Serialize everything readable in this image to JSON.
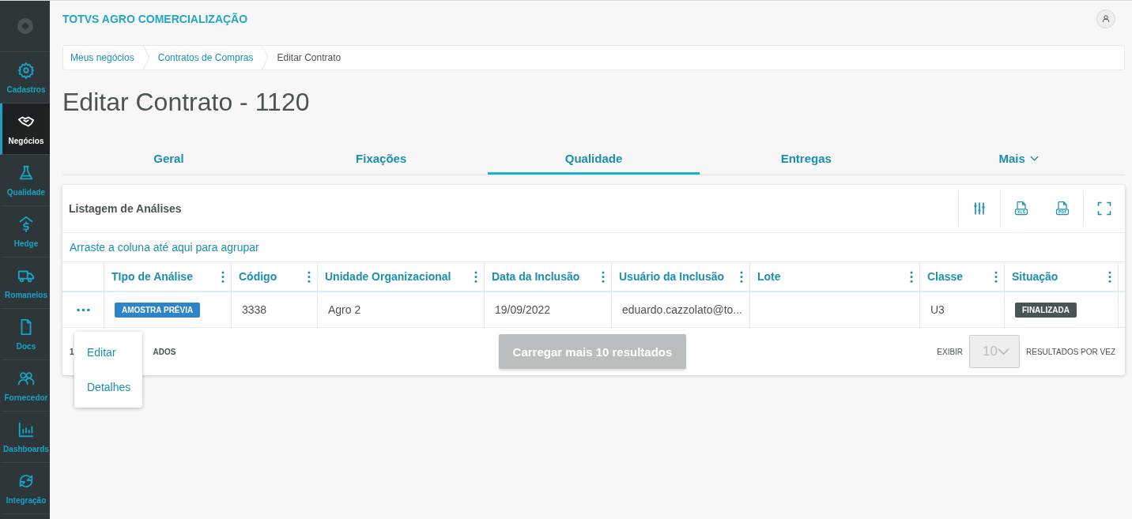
{
  "sidebar": {
    "items": [
      {
        "label": "Cadastros",
        "selected": false
      },
      {
        "label": "Negócios",
        "selected": true
      },
      {
        "label": "Qualidade",
        "selected": false
      },
      {
        "label": "Hedge",
        "selected": false
      },
      {
        "label": "Romaneios",
        "selected": false
      },
      {
        "label": "Docs",
        "selected": false
      },
      {
        "label": "Fornecedor",
        "selected": false
      },
      {
        "label": "Dashboards",
        "selected": false
      },
      {
        "label": "Integração",
        "selected": false
      }
    ]
  },
  "header": {
    "title": "TOTVS AGRO COMERCIALIZAÇÃO"
  },
  "breadcrumb": [
    "Meus negócios",
    "Contratos de Compras",
    "Editar Contrato"
  ],
  "page_title": "Editar Contrato - 1120",
  "tabs": [
    {
      "label": "Geral",
      "selected": false,
      "kind": "plain"
    },
    {
      "label": "Fixações",
      "selected": false,
      "kind": "plain"
    },
    {
      "label": "Qualidade",
      "selected": true,
      "kind": "plain"
    },
    {
      "label": "Entregas",
      "selected": false,
      "kind": "plain"
    },
    {
      "label": "Mais",
      "selected": false,
      "kind": "more"
    }
  ],
  "table": {
    "title": "Listagem de Análises",
    "group_hint": "Arraste a coluna até aqui para agrupar",
    "columns": [
      "TIpo de Análise",
      "Código",
      "Unidade Organizacional",
      "Data da Inclusão",
      "Usuário da Inclusão",
      "Lote",
      "Classe",
      "Situação"
    ],
    "rows": [
      {
        "cells": [
          {
            "kind": "tag",
            "text": "AMOSTRA PRÉVIA",
            "color": "#2c85c8"
          },
          {
            "kind": "text",
            "text": "3338"
          },
          {
            "kind": "text",
            "text": "Agro 2"
          },
          {
            "kind": "text",
            "text": "19/09/2022"
          },
          {
            "kind": "text",
            "text": "eduardo.cazzolato@to..."
          },
          {
            "kind": "empty"
          },
          {
            "kind": "text",
            "text": "U3"
          },
          {
            "kind": "tag",
            "text": "FINALIZADA",
            "color": "#4a5356"
          }
        ]
      }
    ],
    "row_menu": [
      "Editar",
      "Detalhes"
    ],
    "footer": {
      "count_start": "1",
      "count_end": "ADOS",
      "load_more": "Carregar mais 10 resultados",
      "show_label": "EXIBIR",
      "page_size": "10",
      "per_label": "RESULTADOS POR VEZ"
    }
  }
}
